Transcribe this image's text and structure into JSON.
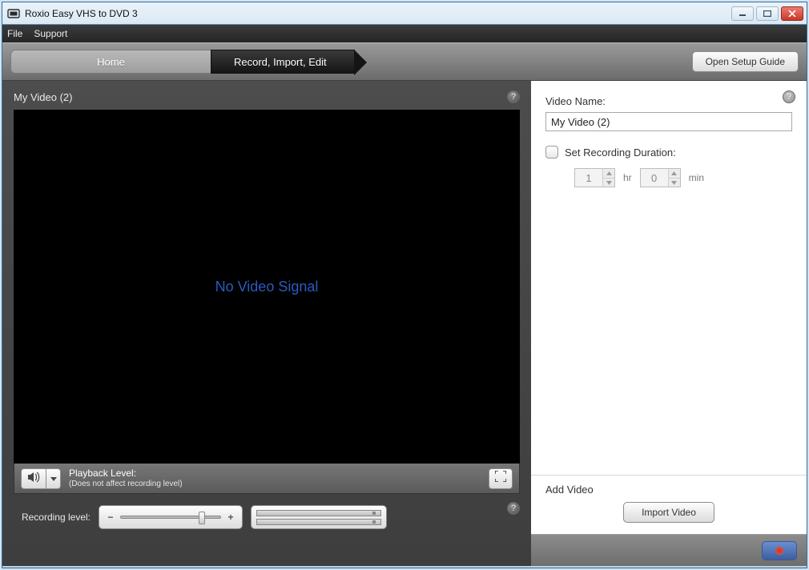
{
  "window": {
    "title": "Roxio Easy VHS to DVD 3"
  },
  "menubar": {
    "items": [
      "File",
      "Support"
    ]
  },
  "toolbar": {
    "tab_home": "Home",
    "tab_record": "Record, Import, Edit",
    "open_guide": "Open Setup Guide"
  },
  "left": {
    "video_title": "My Video (2)",
    "no_signal": "No Video Signal",
    "playback_label": "Playback Level:",
    "playback_sub": "(Does not affect recording level)",
    "recording_label": "Recording level:"
  },
  "right": {
    "video_name_label": "Video Name:",
    "video_name_value": "My Video (2)",
    "set_duration_label": "Set Recording Duration:",
    "hours": "1",
    "hours_unit": "hr",
    "minutes": "0",
    "minutes_unit": "min",
    "add_video_label": "Add Video",
    "import_button": "Import Video"
  }
}
